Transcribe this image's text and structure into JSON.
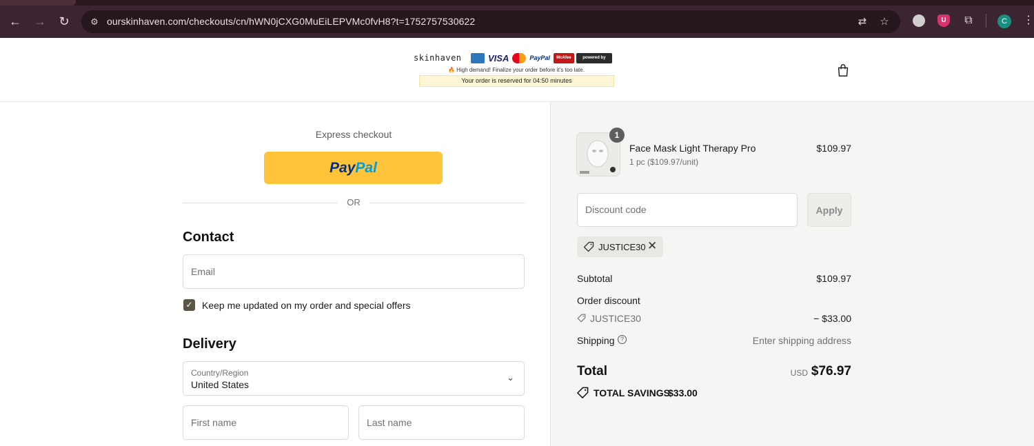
{
  "browser": {
    "url": "ourskinhaven.com/checkouts/cn/hWN0jCXG0MuEiLEPVMc0fvH8?t=1752757530622",
    "profile_initial": "C",
    "extension_badge": "U"
  },
  "header": {
    "brand": "skinhaven",
    "payment_badges": {
      "visa": "VISA",
      "paypal": "PayPal",
      "mcafee": "McAfee SECURE",
      "stripe": "powered by stripe"
    },
    "demand_notice": "🔥 High demand! Finalize your order before it’s too late.",
    "reservation_notice": "Your order is reserved for 04:50 minutes"
  },
  "express": {
    "label": "Express checkout",
    "paypal_part1": "Pay",
    "paypal_part2": "Pal",
    "or": "OR"
  },
  "contact": {
    "title": "Contact",
    "email_placeholder": "Email",
    "marketing_label": "Keep me updated on my order and special offers",
    "marketing_checked": true
  },
  "delivery": {
    "title": "Delivery",
    "country_label": "Country/Region",
    "country_value": "United States",
    "first_name_placeholder": "First name",
    "last_name_placeholder": "Last name"
  },
  "summary": {
    "product": {
      "name": "Face Mask Light Therapy Pro",
      "unit": "1 pc ($109.97/unit)",
      "price": "$109.97",
      "quantity": "1"
    },
    "discount_placeholder": "Discount code",
    "apply_label": "Apply",
    "applied_code": "JUSTICE30",
    "subtotal_label": "Subtotal",
    "subtotal_value": "$109.97",
    "order_discount_label": "Order discount",
    "discount_code": "JUSTICE30",
    "discount_value": "− $33.00",
    "shipping_label": "Shipping",
    "shipping_value": "Enter shipping address",
    "total_label": "Total",
    "currency": "USD",
    "total_value": "$76.97",
    "savings_label": "TOTAL SAVINGS",
    "savings_value": "$33.00"
  },
  "colors": {
    "chrome": "#3c2430",
    "paypal_yellow": "#ffc439",
    "summary_bg": "#f6f5f3",
    "checkbox": "#5b5545"
  }
}
